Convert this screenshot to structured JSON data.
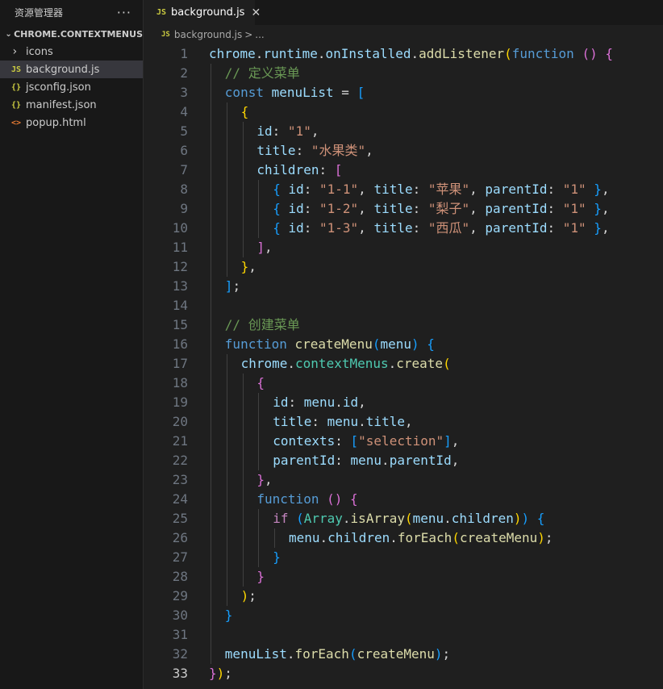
{
  "sidebar": {
    "title": "资源管理器",
    "more": "···",
    "folder": "CHROME.CONTEXTMENUS",
    "items": [
      {
        "icon": "›",
        "label": "icons",
        "kind": "folder"
      },
      {
        "icon": "JS",
        "label": "background.js",
        "kind": "js",
        "selected": true
      },
      {
        "icon": "{}",
        "label": "jsconfig.json",
        "kind": "json"
      },
      {
        "icon": "{}",
        "label": "manifest.json",
        "kind": "json"
      },
      {
        "icon": "<>",
        "label": "popup.html",
        "kind": "html"
      }
    ]
  },
  "tab": {
    "icon": "JS",
    "label": "background.js",
    "close": "✕"
  },
  "breadcrumb": {
    "icon": "JS",
    "file": "background.js",
    "sep": ">",
    "more": "..."
  },
  "colors": {
    "accent": "#0078d4",
    "editor_bg": "#1f1f1f",
    "sidebar_bg": "#181818"
  },
  "current_line": 33,
  "code": [
    {
      "n": "1",
      "g": 0,
      "t": [
        [
          "chrome",
          "v"
        ],
        [
          ".",
          "p"
        ],
        [
          "runtime",
          "v"
        ],
        [
          ".",
          "p"
        ],
        [
          "onInstalled",
          "v"
        ],
        [
          ".",
          "p"
        ],
        [
          "addListener",
          "f"
        ],
        [
          "(",
          "b1"
        ],
        [
          "function",
          "k"
        ],
        [
          " ",
          "p"
        ],
        [
          "()",
          "b2"
        ],
        [
          " ",
          "p"
        ],
        [
          "{",
          "b2"
        ]
      ]
    },
    {
      "n": "2",
      "g": 1,
      "t": [
        [
          "// 定义菜单",
          "c"
        ]
      ]
    },
    {
      "n": "3",
      "g": 1,
      "t": [
        [
          "const",
          "k"
        ],
        [
          " ",
          "p"
        ],
        [
          "menuList",
          "v"
        ],
        [
          " = ",
          "p"
        ],
        [
          "[",
          "b3"
        ]
      ]
    },
    {
      "n": "4",
      "g": 2,
      "t": [
        [
          "{",
          "b1"
        ]
      ]
    },
    {
      "n": "5",
      "g": 3,
      "t": [
        [
          "id",
          "v"
        ],
        [
          ": ",
          "p"
        ],
        [
          "\"1\"",
          "s"
        ],
        [
          ",",
          "p"
        ]
      ]
    },
    {
      "n": "6",
      "g": 3,
      "t": [
        [
          "title",
          "v"
        ],
        [
          ": ",
          "p"
        ],
        [
          "\"水果类\"",
          "s"
        ],
        [
          ",",
          "p"
        ]
      ]
    },
    {
      "n": "7",
      "g": 3,
      "t": [
        [
          "children",
          "v"
        ],
        [
          ": ",
          "p"
        ],
        [
          "[",
          "b2"
        ]
      ]
    },
    {
      "n": "8",
      "g": 4,
      "t": [
        [
          "{",
          "b3"
        ],
        [
          " ",
          "p"
        ],
        [
          "id",
          "v"
        ],
        [
          ": ",
          "p"
        ],
        [
          "\"1-1\"",
          "s"
        ],
        [
          ", ",
          "p"
        ],
        [
          "title",
          "v"
        ],
        [
          ": ",
          "p"
        ],
        [
          "\"苹果\"",
          "s"
        ],
        [
          ", ",
          "p"
        ],
        [
          "parentId",
          "v"
        ],
        [
          ": ",
          "p"
        ],
        [
          "\"1\"",
          "s"
        ],
        [
          " ",
          "p"
        ],
        [
          "}",
          "b3"
        ],
        [
          ",",
          "p"
        ]
      ]
    },
    {
      "n": "9",
      "g": 4,
      "t": [
        [
          "{",
          "b3"
        ],
        [
          " ",
          "p"
        ],
        [
          "id",
          "v"
        ],
        [
          ": ",
          "p"
        ],
        [
          "\"1-2\"",
          "s"
        ],
        [
          ", ",
          "p"
        ],
        [
          "title",
          "v"
        ],
        [
          ": ",
          "p"
        ],
        [
          "\"梨子\"",
          "s"
        ],
        [
          ", ",
          "p"
        ],
        [
          "parentId",
          "v"
        ],
        [
          ": ",
          "p"
        ],
        [
          "\"1\"",
          "s"
        ],
        [
          " ",
          "p"
        ],
        [
          "}",
          "b3"
        ],
        [
          ",",
          "p"
        ]
      ]
    },
    {
      "n": "10",
      "g": 4,
      "t": [
        [
          "{",
          "b3"
        ],
        [
          " ",
          "p"
        ],
        [
          "id",
          "v"
        ],
        [
          ": ",
          "p"
        ],
        [
          "\"1-3\"",
          "s"
        ],
        [
          ", ",
          "p"
        ],
        [
          "title",
          "v"
        ],
        [
          ": ",
          "p"
        ],
        [
          "\"西瓜\"",
          "s"
        ],
        [
          ", ",
          "p"
        ],
        [
          "parentId",
          "v"
        ],
        [
          ": ",
          "p"
        ],
        [
          "\"1\"",
          "s"
        ],
        [
          " ",
          "p"
        ],
        [
          "}",
          "b3"
        ],
        [
          ",",
          "p"
        ]
      ]
    },
    {
      "n": "11",
      "g": 3,
      "t": [
        [
          "]",
          "b2"
        ],
        [
          ",",
          "p"
        ]
      ]
    },
    {
      "n": "12",
      "g": 2,
      "t": [
        [
          "}",
          "b1"
        ],
        [
          ",",
          "p"
        ]
      ]
    },
    {
      "n": "13",
      "g": 1,
      "t": [
        [
          "]",
          "b3"
        ],
        [
          ";",
          "p"
        ]
      ]
    },
    {
      "n": "14",
      "g": 1,
      "t": []
    },
    {
      "n": "15",
      "g": 1,
      "t": [
        [
          "// 创建菜单",
          "c"
        ]
      ]
    },
    {
      "n": "16",
      "g": 1,
      "t": [
        [
          "function",
          "k"
        ],
        [
          " ",
          "p"
        ],
        [
          "createMenu",
          "f"
        ],
        [
          "(",
          "b3"
        ],
        [
          "menu",
          "v"
        ],
        [
          ")",
          "b3"
        ],
        [
          " ",
          "p"
        ],
        [
          "{",
          "b3"
        ]
      ]
    },
    {
      "n": "17",
      "g": 2,
      "t": [
        [
          "chrome",
          "v"
        ],
        [
          ".",
          "p"
        ],
        [
          "contextMenus",
          "t"
        ],
        [
          ".",
          "p"
        ],
        [
          "create",
          "f"
        ],
        [
          "(",
          "b1"
        ]
      ]
    },
    {
      "n": "18",
      "g": 3,
      "t": [
        [
          "{",
          "b2"
        ]
      ]
    },
    {
      "n": "19",
      "g": 4,
      "t": [
        [
          "id",
          "v"
        ],
        [
          ": ",
          "p"
        ],
        [
          "menu",
          "v"
        ],
        [
          ".",
          "p"
        ],
        [
          "id",
          "v"
        ],
        [
          ",",
          "p"
        ]
      ]
    },
    {
      "n": "20",
      "g": 4,
      "t": [
        [
          "title",
          "v"
        ],
        [
          ": ",
          "p"
        ],
        [
          "menu",
          "v"
        ],
        [
          ".",
          "p"
        ],
        [
          "title",
          "v"
        ],
        [
          ",",
          "p"
        ]
      ]
    },
    {
      "n": "21",
      "g": 4,
      "t": [
        [
          "contexts",
          "v"
        ],
        [
          ": ",
          "p"
        ],
        [
          "[",
          "b3"
        ],
        [
          "\"selection\"",
          "s"
        ],
        [
          "]",
          "b3"
        ],
        [
          ",",
          "p"
        ]
      ]
    },
    {
      "n": "22",
      "g": 4,
      "t": [
        [
          "parentId",
          "v"
        ],
        [
          ": ",
          "p"
        ],
        [
          "menu",
          "v"
        ],
        [
          ".",
          "p"
        ],
        [
          "parentId",
          "v"
        ],
        [
          ",",
          "p"
        ]
      ]
    },
    {
      "n": "23",
      "g": 3,
      "t": [
        [
          "}",
          "b2"
        ],
        [
          ",",
          "p"
        ]
      ]
    },
    {
      "n": "24",
      "g": 3,
      "t": [
        [
          "function",
          "k"
        ],
        [
          " ",
          "p"
        ],
        [
          "()",
          "b2"
        ],
        [
          " ",
          "p"
        ],
        [
          "{",
          "b2"
        ]
      ]
    },
    {
      "n": "25",
      "g": 4,
      "t": [
        [
          "if",
          "ctl"
        ],
        [
          " ",
          "p"
        ],
        [
          "(",
          "b3"
        ],
        [
          "Array",
          "t"
        ],
        [
          ".",
          "p"
        ],
        [
          "isArray",
          "f"
        ],
        [
          "(",
          "b1"
        ],
        [
          "menu",
          "v"
        ],
        [
          ".",
          "p"
        ],
        [
          "children",
          "v"
        ],
        [
          ")",
          "b1"
        ],
        [
          ")",
          "b3"
        ],
        [
          " ",
          "p"
        ],
        [
          "{",
          "b3"
        ]
      ]
    },
    {
      "n": "26",
      "g": 5,
      "t": [
        [
          "menu",
          "v"
        ],
        [
          ".",
          "p"
        ],
        [
          "children",
          "v"
        ],
        [
          ".",
          "p"
        ],
        [
          "forEach",
          "f"
        ],
        [
          "(",
          "b1"
        ],
        [
          "createMenu",
          "f"
        ],
        [
          ")",
          "b1"
        ],
        [
          ";",
          "p"
        ]
      ]
    },
    {
      "n": "27",
      "g": 4,
      "t": [
        [
          "}",
          "b3"
        ]
      ]
    },
    {
      "n": "28",
      "g": 3,
      "t": [
        [
          "}",
          "b2"
        ]
      ]
    },
    {
      "n": "29",
      "g": 2,
      "t": [
        [
          ")",
          "b1"
        ],
        [
          ";",
          "p"
        ]
      ]
    },
    {
      "n": "30",
      "g": 1,
      "t": [
        [
          "}",
          "b3"
        ]
      ]
    },
    {
      "n": "31",
      "g": 1,
      "t": []
    },
    {
      "n": "32",
      "g": 1,
      "t": [
        [
          "menuList",
          "v"
        ],
        [
          ".",
          "p"
        ],
        [
          "forEach",
          "f"
        ],
        [
          "(",
          "b3"
        ],
        [
          "createMenu",
          "f"
        ],
        [
          ")",
          "b3"
        ],
        [
          ";",
          "p"
        ]
      ]
    },
    {
      "n": "33",
      "g": 0,
      "t": [
        [
          "}",
          "b2"
        ],
        [
          ")",
          "b1"
        ],
        [
          ";",
          "p"
        ]
      ]
    }
  ]
}
